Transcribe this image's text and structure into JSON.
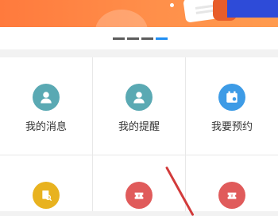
{
  "colors": {
    "banner_orange": "#ff8a45",
    "indicator_active": "#1f8ef3",
    "icon_teal": "#5aa9b3",
    "icon_blue": "#3d9be6",
    "icon_yellow": "#e8b21f",
    "icon_red": "#e05b5b"
  },
  "carousel": {
    "indicator_count": 4,
    "active_index": 3
  },
  "menu": {
    "items": [
      {
        "label": "我的消息",
        "icon": "person-icon"
      },
      {
        "label": "我的提醒",
        "icon": "person-icon"
      },
      {
        "label": "我要预约",
        "icon": "calendar-icon"
      },
      {
        "label": "",
        "icon": "document-search-icon"
      },
      {
        "label": "",
        "icon": "ticket-icon"
      },
      {
        "label": "",
        "icon": "ticket-icon"
      }
    ]
  }
}
